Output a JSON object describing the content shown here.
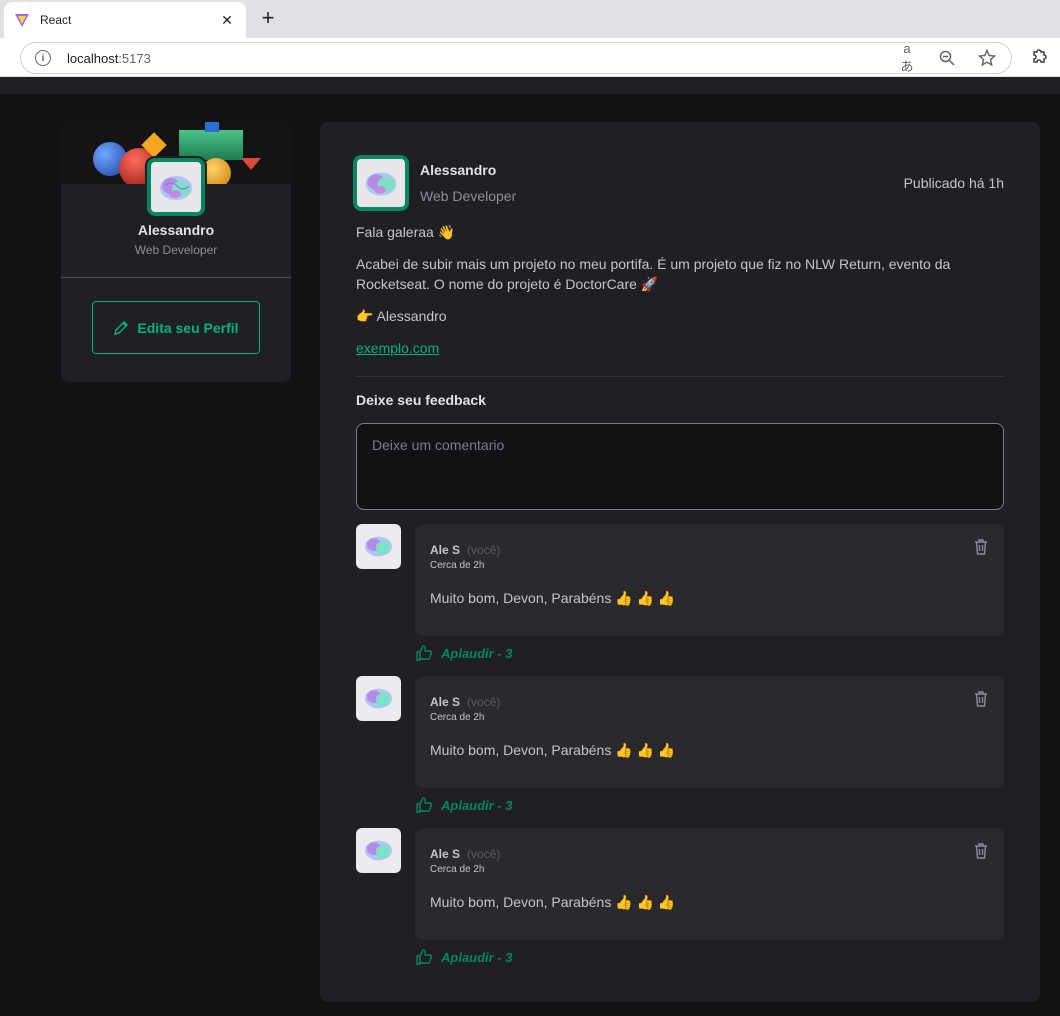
{
  "browser": {
    "tab_title": "React",
    "url_host": "localhost",
    "url_port": ":5173"
  },
  "sidebar": {
    "name": "Alessandro",
    "role": "Web Developer",
    "edit_label": "Edita seu Perfil"
  },
  "post": {
    "author_name": "Alessandro",
    "author_role": "Web Developer",
    "published": "Publicado há 1h",
    "greeting": "Fala galeraa 👋",
    "body": "Acabei de subir mais um projeto no meu portifa. É um projeto que fiz no NLW Return, evento da Rocketseat. O nome do projeto é DoctorCare 🚀",
    "signature": "👉 Alessandro",
    "link": "exemplo.com"
  },
  "feedback": {
    "title": "Deixe seu feedback",
    "placeholder": "Deixe um comentario"
  },
  "comments": [
    {
      "author": "Ale S",
      "you": "(você)",
      "time": "Cerca de 2h",
      "text": "Muito bom, Devon, Parabéns 👍 👍 👍",
      "applaud": "Aplaudir - 3"
    },
    {
      "author": "Ale S",
      "you": "(você)",
      "time": "Cerca de 2h",
      "text": "Muito bom, Devon, Parabéns 👍 👍 👍",
      "applaud": "Aplaudir - 3"
    },
    {
      "author": "Ale S",
      "you": "(você)",
      "time": "Cerca de 2h",
      "text": "Muito bom, Devon, Parabéns 👍 👍 👍",
      "applaud": "Aplaudir - 3"
    }
  ],
  "colors": {
    "accent": "#00b37e",
    "accent_dark": "#00875f",
    "background": "#121214",
    "card": "#202024"
  },
  "icons": {
    "favicon": "vite-logo-icon",
    "info": "info-icon",
    "translate": "translate-icon",
    "zoom": "zoom-out-icon",
    "bookmark": "star-icon",
    "extensions": "puzzle-icon",
    "edit": "pencil-icon",
    "delete": "trash-icon",
    "applaud": "thumbs-up-icon"
  }
}
